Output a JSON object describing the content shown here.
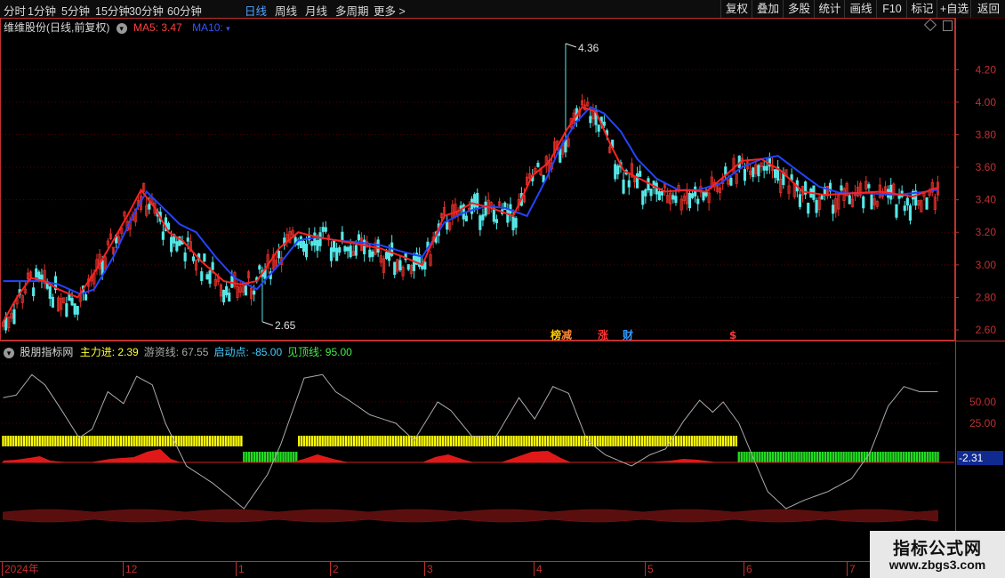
{
  "toolbar": {
    "periods": [
      {
        "label": "分时"
      },
      {
        "label": "1分钟"
      },
      {
        "label": "5分钟"
      },
      {
        "label": "15分钟"
      },
      {
        "label": "30分钟"
      },
      {
        "label": "60分钟"
      },
      {
        "label": "日线",
        "active": true
      },
      {
        "label": "周线"
      },
      {
        "label": "月线"
      },
      {
        "label": "多周期"
      },
      {
        "label": "更多 >"
      }
    ],
    "buttons": [
      {
        "label": "复权"
      },
      {
        "label": "叠加"
      },
      {
        "label": "多股"
      },
      {
        "label": "统计"
      },
      {
        "label": "画线"
      },
      {
        "label": "F10"
      },
      {
        "label": "标记"
      },
      {
        "label": "+自选"
      },
      {
        "label": "返回"
      }
    ]
  },
  "main_legend": {
    "stock": "维维股份(日线,前复权)",
    "ma5_label": "MA5: 3.47",
    "ma10_label": "MA10:"
  },
  "colors": {
    "up": "#e8312a",
    "down": "#56e8e8",
    "ma5": "#ff2222",
    "ma10": "#2244ff",
    "grid": "#5a0000",
    "yellow": "#ffff00",
    "green": "#22dd22",
    "axis": "#c03030"
  },
  "annotations": {
    "high_label": "4.36",
    "low_label": "2.65"
  },
  "event_markers": [
    {
      "text": "榜",
      "color": "#ffcc00"
    },
    {
      "text": "减",
      "color": "#ff8833"
    },
    {
      "text": "涨",
      "color": "#ff3333"
    },
    {
      "text": "财",
      "color": "#3399ff"
    },
    {
      "text": "$",
      "color": "#ff3333"
    }
  ],
  "indicator_legend": {
    "name": "股朋指标网",
    "items": [
      {
        "text": "主力进: 2.39",
        "color": "#ffff33"
      },
      {
        "text": "游资线: 67.55",
        "color": "#aaaaaa"
      },
      {
        "text": "启动点: -85.00",
        "color": "#44ccff"
      },
      {
        "text": "见顶线: 95.00",
        "color": "#44ee44"
      }
    ]
  },
  "indicator_axis": {
    "current_value": "-2.31"
  },
  "x_axis": {
    "labels": [
      "2024年",
      "12",
      "1",
      "2",
      "3",
      "4",
      "5",
      "6",
      "7"
    ]
  },
  "watermark": {
    "line1": "指标公式网",
    "line2": "www.zbgs3.com"
  },
  "chart_data": {
    "type": "line",
    "price_axis": {
      "ticks": [
        4.2,
        4.0,
        3.8,
        3.6,
        3.4,
        3.2,
        3.0,
        2.8,
        2.6
      ],
      "ylim": [
        2.54,
        4.42
      ]
    },
    "indicator_axis": {
      "ticks": [
        50.0,
        25.0
      ]
    },
    "ma5_anchors": [
      [
        0,
        2.65
      ],
      [
        5,
        2.8
      ],
      [
        10,
        2.92
      ],
      [
        15,
        2.9
      ],
      [
        20,
        2.85
      ],
      [
        27,
        2.8
      ],
      [
        33,
        2.95
      ],
      [
        40,
        3.15
      ],
      [
        45,
        3.3
      ],
      [
        50,
        3.46
      ],
      [
        55,
        3.35
      ],
      [
        60,
        3.2
      ],
      [
        65,
        3.15
      ],
      [
        72,
        3.02
      ],
      [
        80,
        2.9
      ],
      [
        86,
        2.88
      ],
      [
        92,
        2.9
      ],
      [
        100,
        3.1
      ],
      [
        107,
        3.2
      ],
      [
        114,
        3.17
      ],
      [
        121,
        3.15
      ],
      [
        128,
        3.13
      ],
      [
        137,
        3.1
      ],
      [
        145,
        3.05
      ],
      [
        152,
        3.0
      ],
      [
        160,
        3.3
      ],
      [
        165,
        3.33
      ],
      [
        170,
        3.38
      ],
      [
        177,
        3.35
      ],
      [
        185,
        3.3
      ],
      [
        192,
        3.55
      ],
      [
        198,
        3.63
      ],
      [
        204,
        3.82
      ],
      [
        210,
        3.97
      ],
      [
        215,
        3.94
      ],
      [
        220,
        3.75
      ],
      [
        225,
        3.58
      ],
      [
        232,
        3.52
      ],
      [
        240,
        3.45
      ],
      [
        248,
        3.46
      ],
      [
        255,
        3.45
      ],
      [
        262,
        3.55
      ],
      [
        268,
        3.64
      ],
      [
        275,
        3.65
      ],
      [
        282,
        3.58
      ],
      [
        290,
        3.45
      ],
      [
        298,
        3.43
      ],
      [
        308,
        3.44
      ],
      [
        318,
        3.45
      ],
      [
        330,
        3.42
      ],
      [
        338,
        3.47
      ]
    ],
    "ma10_anchors": [
      [
        14,
        2.9
      ],
      [
        20,
        2.88
      ],
      [
        28,
        2.82
      ],
      [
        33,
        2.85
      ],
      [
        40,
        3.05
      ],
      [
        47,
        3.3
      ],
      [
        52,
        3.45
      ],
      [
        58,
        3.35
      ],
      [
        64,
        3.25
      ],
      [
        70,
        3.2
      ],
      [
        77,
        3.05
      ],
      [
        84,
        2.92
      ],
      [
        92,
        2.85
      ],
      [
        100,
        3.0
      ],
      [
        107,
        3.15
      ],
      [
        114,
        3.17
      ],
      [
        121,
        3.15
      ],
      [
        128,
        3.14
      ],
      [
        137,
        3.12
      ],
      [
        145,
        3.08
      ],
      [
        152,
        3.05
      ],
      [
        160,
        3.26
      ],
      [
        167,
        3.32
      ],
      [
        175,
        3.36
      ],
      [
        182,
        3.35
      ],
      [
        190,
        3.3
      ],
      [
        197,
        3.53
      ],
      [
        202,
        3.72
      ],
      [
        208,
        3.88
      ],
      [
        213,
        3.97
      ],
      [
        218,
        3.93
      ],
      [
        224,
        3.82
      ],
      [
        230,
        3.65
      ],
      [
        237,
        3.53
      ],
      [
        245,
        3.46
      ],
      [
        252,
        3.46
      ],
      [
        260,
        3.5
      ],
      [
        268,
        3.6
      ],
      [
        275,
        3.65
      ],
      [
        281,
        3.67
      ],
      [
        288,
        3.58
      ],
      [
        296,
        3.48
      ],
      [
        304,
        3.44
      ],
      [
        314,
        3.44
      ],
      [
        324,
        3.43
      ],
      [
        335,
        3.45
      ],
      [
        338,
        3.46
      ]
    ],
    "highest": {
      "index": 204,
      "value": 4.36
    },
    "lowest": {
      "index": 94,
      "value": 2.65
    },
    "lines": [
      {
        "name": "游资线",
        "color": "#aaaaaa",
        "anchors": [
          [
            0,
            55
          ],
          [
            5,
            58
          ],
          [
            11,
            82
          ],
          [
            16,
            70
          ],
          [
            22,
            42
          ],
          [
            29,
            8
          ],
          [
            34,
            18
          ],
          [
            40,
            62
          ],
          [
            46,
            48
          ],
          [
            51,
            80
          ],
          [
            57,
            70
          ],
          [
            62,
            25
          ],
          [
            70,
            -25
          ],
          [
            80,
            -45
          ],
          [
            92,
            -75
          ],
          [
            101,
            -35
          ],
          [
            106,
            0
          ],
          [
            115,
            78
          ],
          [
            122,
            82
          ],
          [
            127,
            62
          ],
          [
            133,
            50
          ],
          [
            140,
            35
          ],
          [
            150,
            25
          ],
          [
            157,
            5
          ],
          [
            166,
            50
          ],
          [
            171,
            40
          ],
          [
            179,
            10
          ],
          [
            188,
            8
          ],
          [
            197,
            55
          ],
          [
            203,
            30
          ],
          [
            210,
            68
          ],
          [
            216,
            60
          ],
          [
            223,
            5
          ],
          [
            230,
            -12
          ],
          [
            240,
            -25
          ],
          [
            247,
            -12
          ],
          [
            253,
            -5
          ],
          [
            260,
            28
          ],
          [
            266,
            52
          ],
          [
            271,
            38
          ],
          [
            275,
            50
          ],
          [
            281,
            25
          ],
          [
            286,
            -12
          ],
          [
            292,
            -55
          ],
          [
            299,
            -75
          ],
          [
            306,
            -65
          ],
          [
            315,
            -55
          ],
          [
            324,
            -40
          ],
          [
            331,
            -10
          ],
          [
            338,
            45
          ],
          [
            344,
            68
          ],
          [
            350,
            62
          ]
        ]
      },
      {
        "name": "主力进",
        "color": "#e01818",
        "type": "area",
        "anchors": [
          [
            0,
            2
          ],
          [
            5,
            3
          ],
          [
            10,
            5
          ],
          [
            14,
            7
          ],
          [
            18,
            2
          ],
          [
            25,
            0
          ],
          [
            33,
            0
          ],
          [
            41,
            4
          ],
          [
            50,
            6
          ],
          [
            55,
            12
          ],
          [
            60,
            15
          ],
          [
            64,
            4
          ],
          [
            68,
            0
          ],
          [
            90,
            0
          ],
          [
            110,
            0
          ],
          [
            115,
            4
          ],
          [
            120,
            9
          ],
          [
            126,
            4
          ],
          [
            132,
            0
          ],
          [
            160,
            0
          ],
          [
            165,
            6
          ],
          [
            170,
            9
          ],
          [
            176,
            3
          ],
          [
            180,
            0
          ],
          [
            190,
            0
          ],
          [
            196,
            6
          ],
          [
            202,
            12
          ],
          [
            208,
            13
          ],
          [
            213,
            5
          ],
          [
            217,
            0
          ],
          [
            245,
            0
          ],
          [
            255,
            2
          ],
          [
            260,
            4
          ],
          [
            265,
            3
          ],
          [
            268,
            2
          ],
          [
            273,
            0
          ],
          [
            350,
            0
          ]
        ]
      }
    ],
    "bar_strip": {
      "yellow_ranges": [
        [
          0,
          91
        ],
        [
          113,
          280
        ]
      ],
      "green_ranges": [
        [
          92,
          112
        ],
        [
          281,
          357
        ]
      ]
    }
  }
}
